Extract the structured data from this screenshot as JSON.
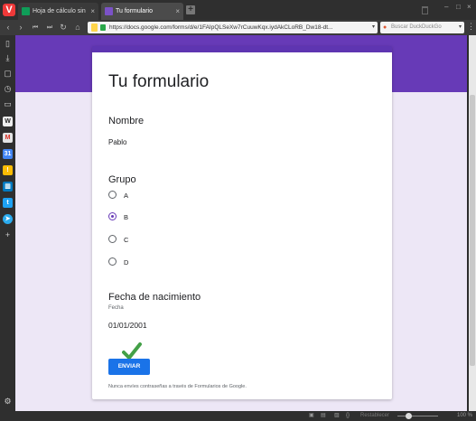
{
  "browser": {
    "logo_letter": "V",
    "tabs": [
      {
        "label": "Hoja de cálculo sin título",
        "close": "×",
        "icon_color": "#0f9d58",
        "icon": "sheets-icon"
      },
      {
        "label": "Tu formulario",
        "close": "×",
        "icon_color": "#7b52c7",
        "icon": "forms-icon"
      }
    ],
    "new_tab": "+",
    "address": "https://docs.google.com/forms/d/e/1FAIpQLSeXw7rCuuwKqx.iydAkCLoRB_Dw18-dt...",
    "search_placeholder": "Buscar DuckDuckGo",
    "nav_icons": [
      "back-icon",
      "forward-icon",
      "first-icon",
      "last-icon",
      "reload-icon",
      "home-icon"
    ],
    "status_zoom": "100 %",
    "status_reset": "Restablecer"
  },
  "sidebar_icons": [
    "bookmarks-icon",
    "downloads-icon",
    "notes-icon",
    "history-icon",
    "window-icon",
    "wikipedia-icon",
    "gmail-icon",
    "calendar-icon",
    "keep-icon",
    "trello-icon",
    "twitter-icon",
    "telegram-icon",
    "add-panel-icon"
  ],
  "form": {
    "title": "Tu formulario",
    "questions": {
      "nombre": {
        "label": "Nombre",
        "answer": "Pablo"
      },
      "grupo": {
        "label": "Grupo",
        "options": [
          "A",
          "B",
          "C",
          "D"
        ],
        "selected": "B"
      },
      "fecha": {
        "label": "Fecha de nacimiento",
        "sublabel": "Fecha",
        "answer": "01/01/2001"
      }
    },
    "submit_label": "ENVIAR",
    "footer": "Nunca envíes contraseñas a través de Formularios de Google."
  },
  "colors": {
    "accent": "#673ab7",
    "submit": "#1a73e8",
    "check": "#43a047",
    "background": "#ede7f6"
  }
}
